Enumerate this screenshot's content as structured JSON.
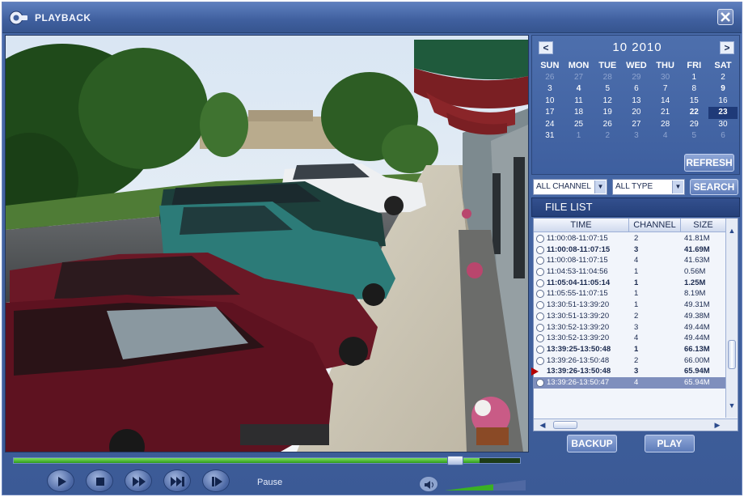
{
  "window": {
    "title": "PLAYBACK",
    "logo_icon": "camera-logo-icon",
    "close_icon": "close-icon"
  },
  "calendar": {
    "month_label": "10  2010",
    "prev_label": "<",
    "next_label": ">",
    "weekdays": [
      "SUN",
      "MON",
      "TUE",
      "WED",
      "THU",
      "FRI",
      "SAT"
    ],
    "weeks": [
      [
        "26",
        "27",
        "28",
        "29",
        "30",
        "1",
        "2"
      ],
      [
        "3",
        "4",
        "5",
        "6",
        "7",
        "8",
        "9"
      ],
      [
        "10",
        "11",
        "12",
        "13",
        "14",
        "15",
        "16"
      ],
      [
        "17",
        "18",
        "19",
        "20",
        "21",
        "22",
        "23"
      ],
      [
        "24",
        "25",
        "26",
        "27",
        "28",
        "29",
        "30"
      ],
      [
        "31",
        "1",
        "2",
        "3",
        "4",
        "5",
        "6"
      ]
    ],
    "selected_day": "23",
    "refresh_label": "REFRESH"
  },
  "filters": {
    "channel_value": "ALL CHANNEL",
    "type_value": "ALL TYPE",
    "search_label": "SEARCH"
  },
  "file_list": {
    "title": "FILE LIST",
    "columns": [
      "TIME",
      "CHANNEL",
      "SIZE"
    ],
    "rows": [
      {
        "time": "11:00:08-11:07:15",
        "channel": "2",
        "size": "41.81M"
      },
      {
        "time": "11:00:08-11:07:15",
        "channel": "3",
        "size": "41.69M"
      },
      {
        "time": "11:00:08-11:07:15",
        "channel": "4",
        "size": "41.63M"
      },
      {
        "time": "11:04:53-11:04:56",
        "channel": "1",
        "size": "0.56M"
      },
      {
        "time": "11:05:04-11:05:14",
        "channel": "1",
        "size": "1.25M"
      },
      {
        "time": "11:05:55-11:07:15",
        "channel": "1",
        "size": "8.19M"
      },
      {
        "time": "13:30:51-13:39:20",
        "channel": "1",
        "size": "49.31M"
      },
      {
        "time": "13:30:51-13:39:20",
        "channel": "2",
        "size": "49.38M"
      },
      {
        "time": "13:30:52-13:39:20",
        "channel": "3",
        "size": "49.44M"
      },
      {
        "time": "13:30:52-13:39:20",
        "channel": "4",
        "size": "49.44M"
      },
      {
        "time": "13:39:25-13:50:48",
        "channel": "1",
        "size": "66.13M"
      },
      {
        "time": "13:39:26-13:50:48",
        "channel": "2",
        "size": "66.00M"
      },
      {
        "time": "13:39:26-13:50:48",
        "channel": "3",
        "size": "65.94M"
      },
      {
        "time": "13:39:26-13:50:47",
        "channel": "4",
        "size": "65.94M"
      }
    ],
    "playing_row": 12,
    "selected_row": 13
  },
  "actions": {
    "backup_label": "BACKUP",
    "play_label": "PLAY"
  },
  "playback": {
    "status": "Pause",
    "progress": 0.92,
    "volume": 0.6,
    "buttons": [
      "play-icon",
      "stop-icon",
      "fast-forward-icon",
      "next-frame-icon",
      "step-icon"
    ]
  },
  "colors": {
    "panel": "#3e5f9f",
    "progress": "#3ab024",
    "marker": "#b40000"
  }
}
